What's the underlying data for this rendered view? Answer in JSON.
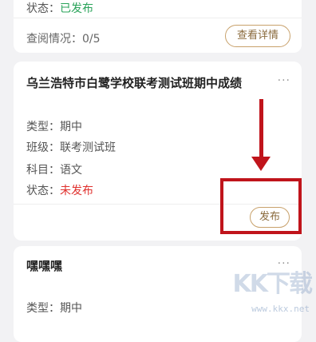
{
  "card1": {
    "status_label": "状态：",
    "status_value": "已发布",
    "view_label": "查阅情况：0/5",
    "details_button": "查看详情"
  },
  "card2": {
    "title": "乌兰浩特市白鹭学校联考测试班期中成绩",
    "more": "···",
    "type_label": "类型：",
    "type_value": "期中",
    "class_label": "班级：",
    "class_value": "联考测试班",
    "subject_label": "科目：",
    "subject_value": "语文",
    "status_label": "状态：",
    "status_value": "未发布",
    "publish_button": "发布"
  },
  "card3": {
    "title": "嘿嘿嘿",
    "more": "···",
    "type_label": "类型：",
    "type_value": "期中"
  },
  "colors": {
    "published": "#2aa35a",
    "unpublished": "#e0322f",
    "button_border": "#c8a16b",
    "annotation": "#c0141b"
  },
  "watermark": {
    "logo_text": "KK下载",
    "url": "www.kkx.net"
  }
}
